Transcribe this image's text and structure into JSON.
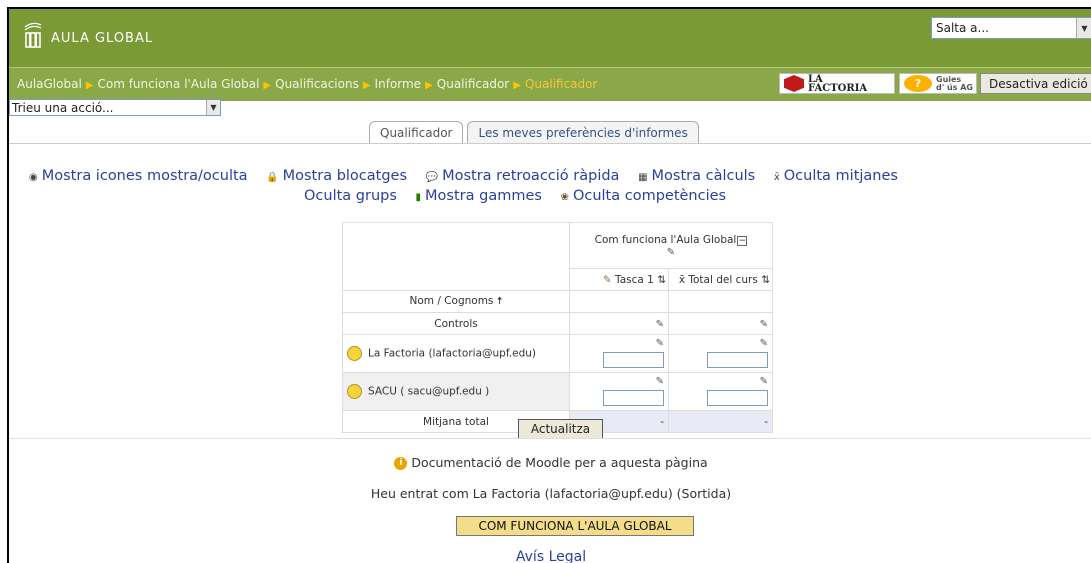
{
  "header": {
    "logo_text": "AULA GLOBAL",
    "jump_select": "Salta a..."
  },
  "breadcrumbs": [
    "AulaGlobal",
    "Com funciona l'Aula Global",
    "Qualificacions",
    "Informe",
    "Qualificador",
    "Qualificador"
  ],
  "badges": {
    "factoria_line1": "LA",
    "factoria_line2": "FACTORIA",
    "guies_line1": "Guies",
    "guies_line2": "d' ús AG",
    "edit_button": "Desactiva edició"
  },
  "action_select": "Trieu una acció...",
  "tabs": [
    {
      "label": "Qualificador",
      "active": true
    },
    {
      "label": "Les meves preferències d'informes",
      "active": false
    }
  ],
  "options_row1": [
    {
      "icon": "eye-icon",
      "glyph": "◉",
      "label": "Mostra icones mostra/oculta"
    },
    {
      "icon": "lock-icon",
      "glyph": "🔒",
      "label": "Mostra blocatges"
    },
    {
      "icon": "comment-icon",
      "glyph": "💬",
      "label": "Mostra retroacció ràpida"
    },
    {
      "icon": "calculator-icon",
      "glyph": "▦",
      "label": "Mostra càlculs"
    },
    {
      "icon": "mean-icon",
      "glyph": "x̄",
      "label": "Oculta mitjanes"
    }
  ],
  "options_row2": [
    {
      "icon": "group-icon",
      "label": "Oculta grups"
    },
    {
      "icon": "ranges-icon",
      "label": "Mostra gammes"
    },
    {
      "icon": "competencies-icon",
      "label": "Oculta competències"
    }
  ],
  "grader": {
    "course_header": "Com funciona l'Aula Global",
    "name_header": "Nom / Cognoms",
    "col_task": "Tasca 1",
    "col_total": "Total del curs",
    "controls_label": "Controls",
    "students": [
      {
        "name": "La Factoria (lafactoria@upf.edu)"
      },
      {
        "name": "SACU ( sacu@upf.edu )"
      }
    ],
    "average_label": "Mitjana total",
    "average_task": "-",
    "average_total": "-"
  },
  "update_button": "Actualitza",
  "footer": {
    "doc_link": "Documentació de Moodle per a aquesta pàgina",
    "login_info": "Heu entrat com La Factoria (lafactoria@upf.edu) (Sortida)",
    "home_button": "COM FUNCIONA L'AULA GLOBAL",
    "legal": "Avís Legal"
  },
  "colors": {
    "header": "#7a9a36",
    "navbar": "#8aa848",
    "crumb_current": "#f7c53a",
    "link": "#2a3fa0"
  }
}
